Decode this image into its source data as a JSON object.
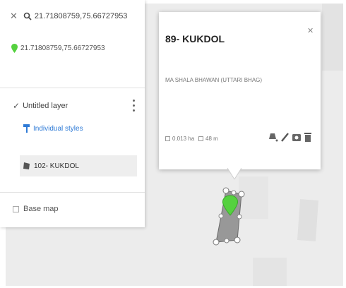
{
  "search": {
    "query": "21.71808759,75.66727953",
    "result": "21.71808759,75.66727953"
  },
  "layer": {
    "name": "Untitled layer",
    "style_link": "Individual styles",
    "feature": "102- KUKDOL",
    "basemap_label": "Base map"
  },
  "popup": {
    "title": "89- KUKDOL",
    "subtitle": "MA SHALA BHAWAN (UTTARI BHAG)",
    "area": "0.013 ha",
    "perimeter": "48 m"
  },
  "colors": {
    "accent": "#2f7bd6",
    "marker": "#55d13f",
    "polygon": "#8a8a8a",
    "map_bg": "#ececec"
  }
}
